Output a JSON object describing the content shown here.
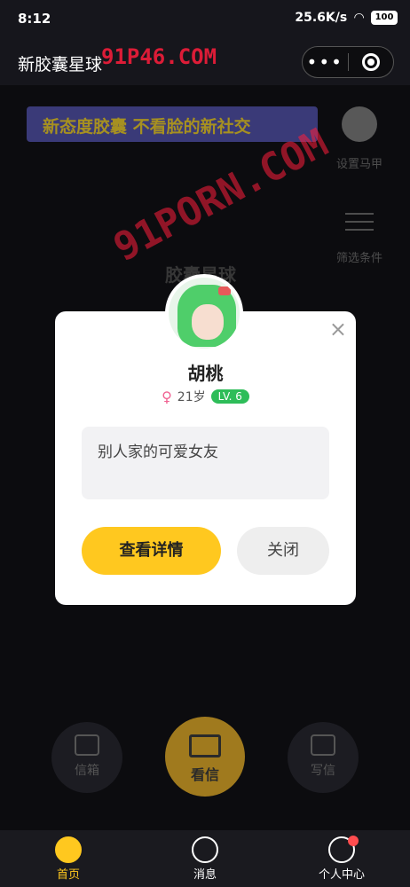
{
  "status_bar": {
    "time": "8:12",
    "network_speed": "25.6K/s",
    "battery": "100"
  },
  "title_bar": {
    "title": "新胶囊星球",
    "more_label": "•••"
  },
  "watermark": {
    "text1": "91P46.COM",
    "text2": "91PORN.COM"
  },
  "banner": {
    "text": "新态度胶囊 不看脸的新社交"
  },
  "side_menu": {
    "set_mask_label": "设置马甲",
    "filter_label": "筛选条件"
  },
  "planet_title": "胶囊星球",
  "modal": {
    "name": "胡桃",
    "gender_symbol": "♀",
    "age": "21岁",
    "level": "LV. 6",
    "bio": "别人家的可爱女友",
    "detail_button": "查看详情",
    "close_button": "关闭",
    "close_icon": "×"
  },
  "actions": {
    "inbox_label": "信箱",
    "see_letter_label": "看信",
    "write_label": "写信"
  },
  "tab_bar": {
    "items": [
      {
        "label": "首页",
        "icon": "planet-icon",
        "active": true
      },
      {
        "label": "消息",
        "icon": "message-icon",
        "active": false
      },
      {
        "label": "个人中心",
        "icon": "user-icon",
        "active": false
      }
    ]
  },
  "colors": {
    "accent": "#ffc81f",
    "level_badge": "#2ebd59",
    "background": "#131318"
  }
}
